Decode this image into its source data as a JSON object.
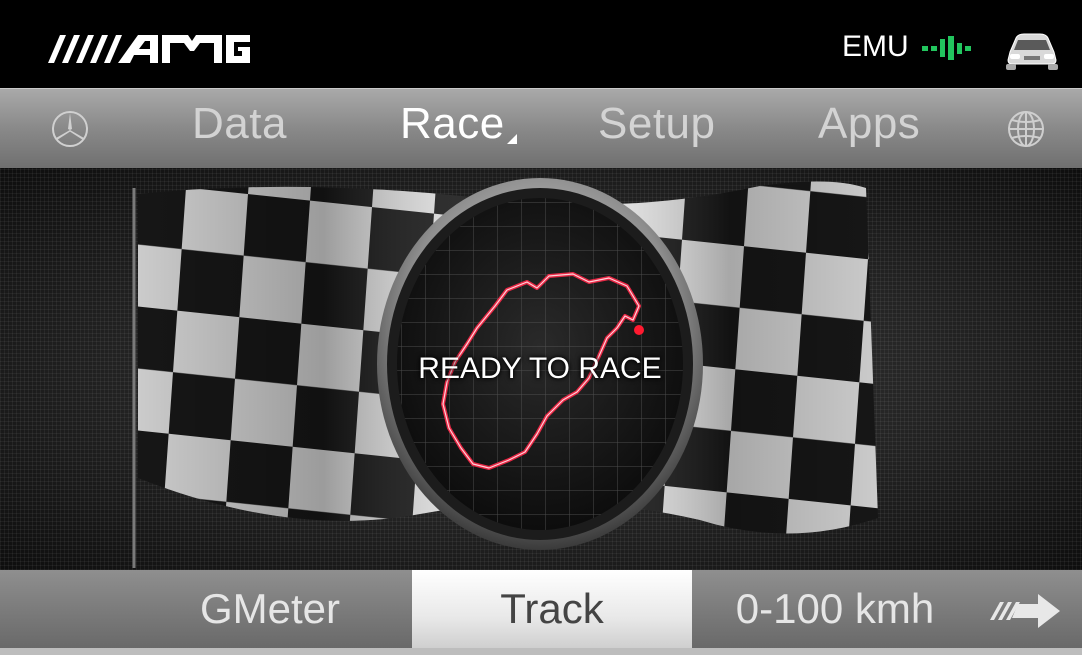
{
  "header": {
    "brand": "AMG",
    "emu_label": "EMU",
    "colors": {
      "signal": "#22c55e"
    }
  },
  "menu": {
    "items": [
      {
        "label": "Data"
      },
      {
        "label": "Race",
        "active": true
      },
      {
        "label": "Setup"
      },
      {
        "label": "Apps"
      }
    ]
  },
  "main": {
    "status_text": "READY TO RACE",
    "colors": {
      "track_glow": "#ff2a4a"
    }
  },
  "tabs": {
    "items": [
      {
        "label": "GMeter"
      },
      {
        "label": "Track",
        "active": true
      },
      {
        "label": "0-100 kmh"
      }
    ],
    "colors": {
      "active_underline": "#d0102b"
    }
  }
}
